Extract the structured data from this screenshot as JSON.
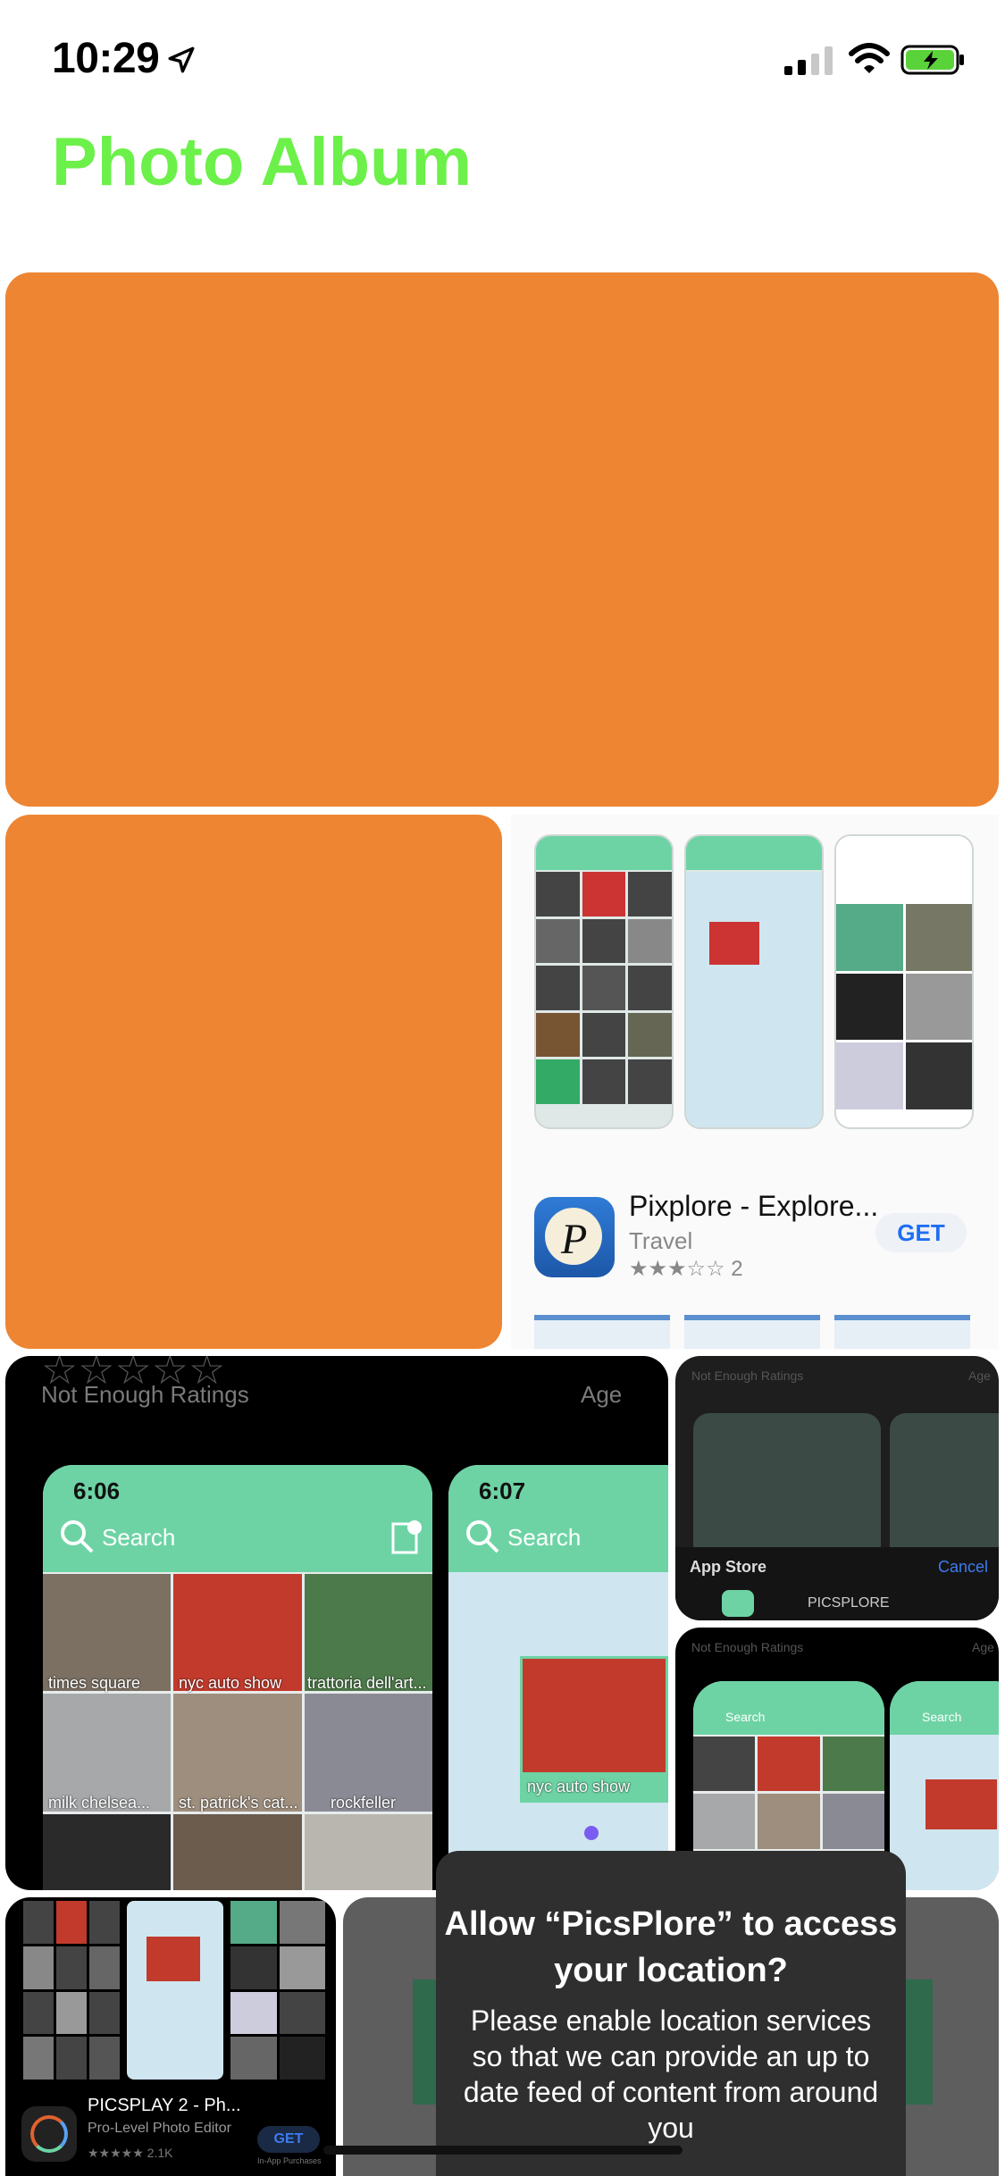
{
  "status_bar": {
    "time": "10:29"
  },
  "header": {
    "title": "Photo Album"
  },
  "store_card": {
    "app_name": "Pixplore - Explore...",
    "category": "Travel",
    "rating_count": "2",
    "get_label": "GET"
  },
  "black_tile_large": {
    "ratings_text": "Not Enough Ratings",
    "age_label": "Age",
    "phone1": {
      "time": "6:06",
      "search": "Search"
    },
    "phone2": {
      "time": "6:07",
      "search": "Search"
    },
    "photo_labels": [
      "times square",
      "nyc auto show",
      "trattoria dell'art...",
      "milk chelsea...",
      "st. patrick's cat...",
      "rockfeller"
    ],
    "map_label": "nyc auto show"
  },
  "share_sheet": {
    "ratings_text": "Not Enough Ratings",
    "age_label": "Age",
    "title": "App Store",
    "cancel": "Cancel",
    "app": "PICSPLORE"
  },
  "black_tile_small": {
    "ratings_text": "Not Enough Ratings",
    "age_label": "Age",
    "search": "Search"
  },
  "picsplay": {
    "name": "PICSPLAY 2 - Ph...",
    "subtitle": "Pro-Level Photo Editor",
    "get": "GET",
    "rating_count": "2.1K",
    "iap": "In-App Purchases"
  },
  "location_dialog": {
    "title": "Allow “PicsPlore” to access your location?",
    "body": "Please enable location services so that we can provide an up to date feed of content from around you"
  },
  "colors": {
    "accent": "#6cf04a",
    "orange": "#ee8533",
    "mint": "#6dd3a4"
  }
}
